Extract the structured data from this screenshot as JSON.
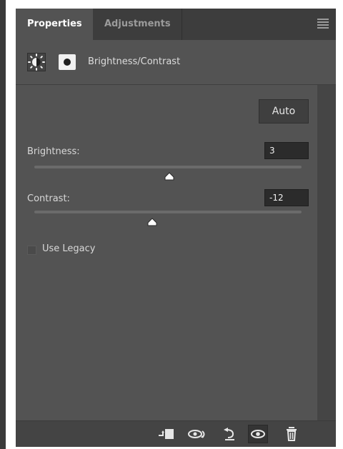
{
  "panel": {
    "tabs": [
      {
        "label": "Properties",
        "active": true
      },
      {
        "label": "Adjustments",
        "active": false
      }
    ],
    "menu_icon": "hamburger-menu-icon"
  },
  "header": {
    "title": "Brightness/Contrast",
    "icons": [
      "brightness-icon",
      "layer-mask-icon"
    ]
  },
  "controls": {
    "auto_label": "Auto",
    "brightness": {
      "label": "Brightness:",
      "value": "3",
      "slider_fraction": 0.506
    },
    "contrast": {
      "label": "Contrast:",
      "value": "-12",
      "slider_fraction": 0.44
    },
    "use_legacy": {
      "label": "Use Legacy",
      "checked": false
    }
  },
  "footer": {
    "icons": [
      "clip-to-layer-icon",
      "view-previous-state-icon",
      "reset-icon",
      "visibility-eye-icon",
      "trash-icon"
    ]
  },
  "colors": {
    "panel_bg": "#535353",
    "tab_active": "#ffffff",
    "tab_inactive": "#9b9b9b"
  }
}
